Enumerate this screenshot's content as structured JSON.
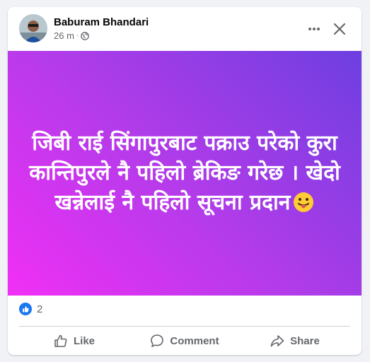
{
  "post": {
    "author": "Baburam Bhandari",
    "time": "26 m",
    "separator": "·",
    "privacy_icon": "globe-icon",
    "text": "जिबी राई सिंगापुरबाट पक्राउ परेको कुरा कान्तिपुरले नै पहिलो ब्रेकिङ गरेछ । खेदो खन्नेलाई नै पहिलो सूचना प्रदान",
    "emoji": "tongue-out-emoji",
    "gradient": [
      "#f12ff5",
      "#b63bea",
      "#6d3fe0"
    ]
  },
  "reactions": {
    "icon": "like-reaction-icon",
    "count": "2",
    "color": "#1877f2"
  },
  "actions": {
    "like_label": "Like",
    "comment_label": "Comment",
    "share_label": "Share"
  },
  "header_buttons": {
    "more_icon": "more-options-icon",
    "close_icon": "close-icon"
  }
}
